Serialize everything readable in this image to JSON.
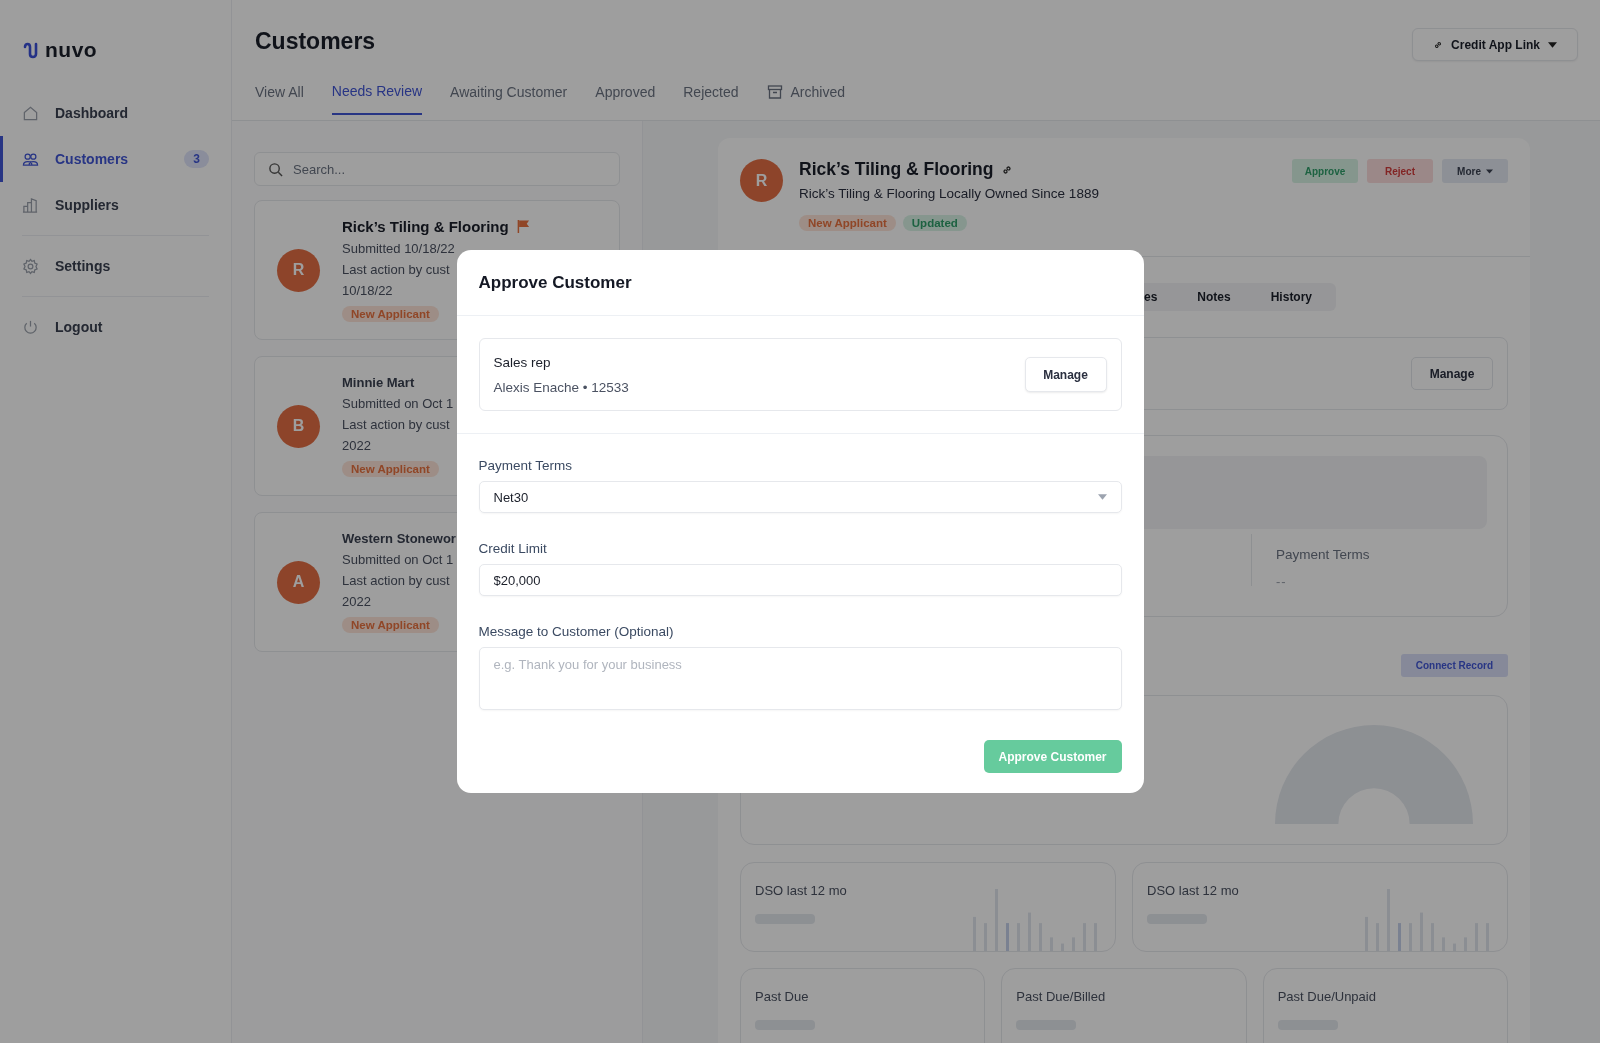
{
  "sidebar": {
    "logo": "nuvo",
    "groups": [
      {
        "items": [
          {
            "label": "Dashboard",
            "selected": false
          },
          {
            "label": "Customers",
            "selected": true,
            "badge": "3"
          },
          {
            "label": "Suppliers",
            "selected": false
          }
        ]
      },
      {
        "items": [
          {
            "label": "Settings",
            "selected": false
          }
        ]
      },
      {
        "items": [
          {
            "label": "Logout",
            "selected": false
          }
        ]
      }
    ]
  },
  "header": {
    "title": "Customers",
    "link_button": "Credit App Link"
  },
  "tabs": [
    {
      "label": "View All",
      "selected": false,
      "kind": "text"
    },
    {
      "label": "Needs Review",
      "selected": true,
      "kind": "text"
    },
    {
      "label": "Awaiting Customer",
      "selected": false,
      "kind": "text"
    },
    {
      "label": "Approved",
      "selected": false,
      "kind": "text"
    },
    {
      "label": "Rejected",
      "selected": false,
      "kind": "text"
    },
    {
      "label": "Archived",
      "selected": false,
      "kind": "archive"
    }
  ],
  "search": {
    "placeholder": "Search..."
  },
  "customers": [
    {
      "initial": "R",
      "name": "Rick’s Tiling & Flooring",
      "flagged": true,
      "lines": [
        "Submitted 10/18/22",
        "Last action by cust",
        "10/18/22"
      ],
      "tags": [
        {
          "label": "New Applicant",
          "kind": "new"
        }
      ]
    },
    {
      "initial": "B",
      "name": "Minnie Mart",
      "flagged": false,
      "lines": [
        "Submitted on Oct 1",
        "Last action by cust",
        "2022"
      ],
      "tags": [
        {
          "label": "New Applicant",
          "kind": "new"
        }
      ]
    },
    {
      "initial": "A",
      "name": "Western Stonewor",
      "flagged": false,
      "lines": [
        "Submitted on Oct 1",
        "Last action by cust",
        "2022"
      ],
      "tags": [
        {
          "label": "New Applicant",
          "kind": "new"
        }
      ]
    }
  ],
  "detail": {
    "initial": "R",
    "name": "Rick’s Tiling & Flooring",
    "subtitle": "Rick’s Tiling & Flooring Locally Owned Since 1889",
    "tags": [
      {
        "label": "New Applicant",
        "kind": "new"
      },
      {
        "label": "Updated",
        "kind": "updated"
      }
    ],
    "actions": [
      {
        "label": "Approve",
        "kind": "approve"
      },
      {
        "label": "Reject",
        "kind": "reject"
      },
      {
        "label": "More",
        "kind": "more"
      }
    ],
    "subtabs": [
      "es",
      "Notes",
      "History"
    ],
    "manage_button": "Manage",
    "terms_label": "Payment Terms",
    "terms_value": "--",
    "connect_button": "Connect Record",
    "dso_cards": [
      "DSO last 12 mo",
      "DSO last 12 mo"
    ],
    "past_due_cards": [
      "Past Due",
      "Past Due/Billed",
      "Past Due/Unpaid"
    ]
  },
  "modal": {
    "title": "Approve Customer",
    "sales_rep": {
      "label": "Sales rep",
      "value": "Alexis Enache • 12533",
      "button": "Manage"
    },
    "fields": [
      {
        "kind": "select",
        "label": "Payment Terms",
        "value": "Net30"
      },
      {
        "kind": "input",
        "label": "Credit Limit",
        "value": "$20,000"
      },
      {
        "kind": "textarea",
        "label": "Message to Customer (Optional)",
        "placeholder": "e.g. Thank you for your business"
      }
    ],
    "submit": "Approve Customer"
  }
}
